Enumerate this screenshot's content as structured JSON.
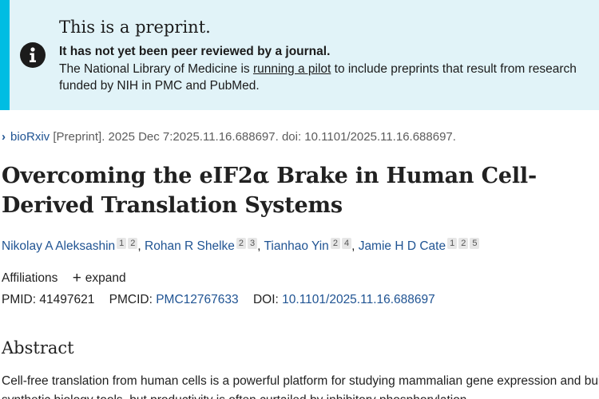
{
  "banner": {
    "title": "This is a preprint.",
    "subtitle": "It has not yet been peer reviewed by a journal.",
    "body_prefix": "The National Library of Medicine is ",
    "link_text": "running a pilot",
    "body_suffix": " to include preprints that result from research funded by NIH in PMC and PubMed.",
    "icon": "info-icon",
    "accent_color": "#00bde3",
    "background_color": "#e1f3f8"
  },
  "citation": {
    "journal": "bioRxiv",
    "rest": " [Preprint]. 2025 Dec 7:2025.11.16.688697. doi: 10.1101/2025.11.16.688697."
  },
  "article": {
    "title": "Overcoming the eIF2α Brake in Human Cell-Derived Translation Systems"
  },
  "authors": [
    {
      "name": "Nikolay A Aleksashin",
      "affils": [
        "1",
        "2"
      ]
    },
    {
      "name": "Rohan R Shelke",
      "affils": [
        "2",
        "3"
      ]
    },
    {
      "name": "Tianhao Yin",
      "affils": [
        "2",
        "4"
      ]
    },
    {
      "name": "Jamie H D Cate",
      "affils": [
        "1",
        "2",
        "5"
      ]
    }
  ],
  "affiliations": {
    "label": "Affiliations",
    "expand_label": "expand"
  },
  "identifiers": {
    "pmid_label": "PMID:",
    "pmid": "41497621",
    "pmcid_label": "PMCID:",
    "pmcid": "PMC12767633",
    "doi_label": "DOI:",
    "doi": "10.1101/2025.11.16.688697"
  },
  "abstract": {
    "heading": "Abstract",
    "text": "Cell-free translation from human cells is a powerful platform for studying mammalian gene expression and building synthetic biology tools, but productivity is often curtailed by inhibitory phosphorylation"
  },
  "colors": {
    "link": "#205493",
    "text": "#212121"
  }
}
